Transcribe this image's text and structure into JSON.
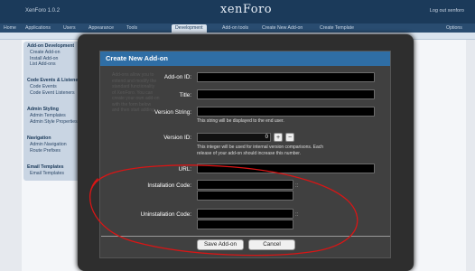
{
  "header": {
    "brand_left": "XenForo 1.0.2",
    "logo": "xenForo",
    "logout": "Log out xenforo"
  },
  "nav": {
    "tabs": [
      "Home",
      "Applications",
      "Users",
      "Appearance",
      "Tools",
      "Development",
      "Add-on tools",
      "Create New Add-on",
      "Create Template"
    ],
    "active_tab": "Development",
    "right_link": "Options"
  },
  "sidebar": {
    "groups": [
      {
        "head": "Add-on Development",
        "items": [
          "Create Add-on",
          "Install Add-on",
          "List Add-ons"
        ]
      },
      {
        "head": "Code Events & Listeners",
        "items": [
          "Code Events",
          "Code Event Listeners"
        ]
      },
      {
        "head": "Admin Styling",
        "items": [
          "Admin Templates",
          "Admin Style Properties"
        ]
      },
      {
        "head": "Navigation",
        "items": [
          "Admin Navigation",
          "Route Prefixes"
        ]
      },
      {
        "head": "Email Templates",
        "items": [
          "Email Templates"
        ]
      }
    ]
  },
  "dialog": {
    "title": "Create New Add-on",
    "fields": {
      "addon_id": {
        "label": "Add-on ID:",
        "value": ""
      },
      "title": {
        "label": "Title:",
        "value": ""
      },
      "version_string": {
        "label": "Version String:",
        "value": "",
        "hint": "This string will be displayed to the end user."
      },
      "version_id": {
        "label": "Version ID:",
        "value": "0",
        "hint_line1": "This integer will be used for internal version comparisons. Each",
        "hint_line2": "release of your add-on should increase this number."
      },
      "url": {
        "label": "URL:",
        "value": ""
      },
      "install_code": {
        "label": "Installation Code:",
        "value_class": "",
        "value_method": ""
      },
      "uninstall_code": {
        "label": "Uninstallation Code:",
        "value_class": "",
        "value_method": ""
      }
    },
    "buttons": {
      "save": "Save Add-on",
      "cancel": "Cancel"
    }
  },
  "background_faded_text": [
    "Add-ons allow you to",
    "extend and modify the",
    "standard functionality",
    "of XenForo. You can",
    "create your own add-on",
    "with the form below",
    "and then start adding"
  ],
  "annotation": {
    "color": "#d91515"
  }
}
